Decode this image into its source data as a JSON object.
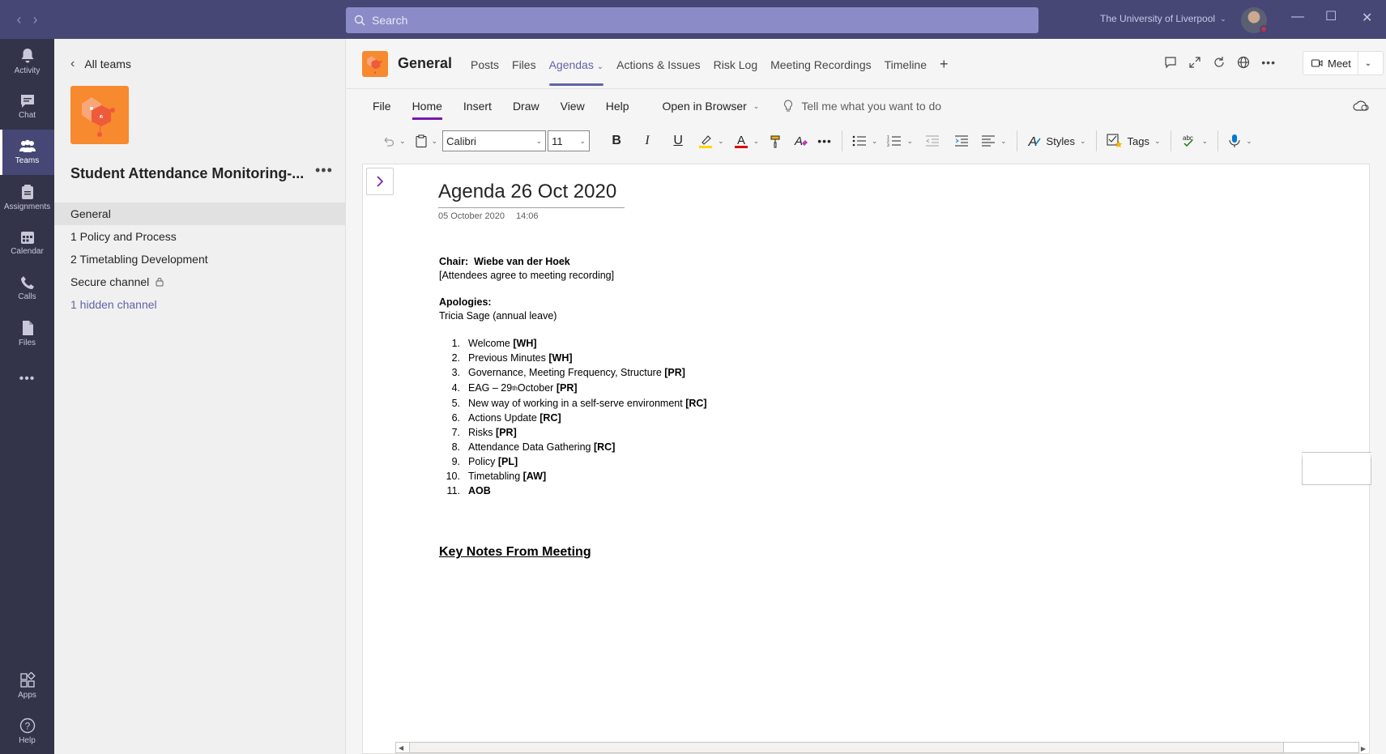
{
  "titlebar": {
    "back_label": "‹",
    "forward_label": "›",
    "search_placeholder": "Search",
    "org_name": "The University of Liverpool",
    "minimize": "—",
    "maximize": "☐",
    "close": "✕"
  },
  "rail": {
    "items": [
      {
        "label": "Activity",
        "icon": "bell-icon"
      },
      {
        "label": "Chat",
        "icon": "chat-icon"
      },
      {
        "label": "Teams",
        "icon": "teams-icon",
        "active": true
      },
      {
        "label": "Assignments",
        "icon": "assignments-icon"
      },
      {
        "label": "Calendar",
        "icon": "calendar-icon"
      },
      {
        "label": "Calls",
        "icon": "phone-icon"
      },
      {
        "label": "Files",
        "icon": "files-icon"
      }
    ],
    "more": "•••",
    "bottom": [
      {
        "label": "Apps",
        "icon": "apps-icon"
      },
      {
        "label": "Help",
        "icon": "help-icon"
      }
    ]
  },
  "pane": {
    "all_teams": "All teams",
    "team_name": "Student Attendance Monitoring-...",
    "more": "•••",
    "channels": [
      {
        "label": "General",
        "active": true
      },
      {
        "label": "1 Policy and Process"
      },
      {
        "label": "2 Timetabling Development"
      },
      {
        "label": "Secure channel",
        "locked": true
      },
      {
        "label": "1 hidden channel",
        "link": true
      }
    ]
  },
  "header": {
    "channel_title": "General",
    "tabs": [
      {
        "label": "Posts"
      },
      {
        "label": "Files"
      },
      {
        "label": "Agendas",
        "active": true
      },
      {
        "label": "Actions & Issues"
      },
      {
        "label": "Risk Log"
      },
      {
        "label": "Meeting Recordings"
      },
      {
        "label": "Timeline"
      },
      {
        "label": "+"
      }
    ],
    "meet_label": "Meet"
  },
  "ribbon": {
    "menu": [
      "File",
      "Home",
      "Insert",
      "Draw",
      "View",
      "Help"
    ],
    "active_menu": "Home",
    "open_in_browser": "Open in Browser",
    "tell_me": "Tell me what you want to do",
    "font_name": "Calibri",
    "font_size": "11",
    "styles": "Styles",
    "tags": "Tags",
    "spell": "abc"
  },
  "page": {
    "title": "Agenda 26 Oct 2020",
    "date": "05 October 2020",
    "time": "14:06",
    "chair_label": "Chair:",
    "chair_name": "Wiebe van der Hoek",
    "attendees_note": "[Attendees agree to meeting recording]",
    "apologies_label": "Apologies:",
    "apologies": "Tricia Sage (annual leave)",
    "agenda": [
      {
        "num": "1.",
        "text": "Welcome ",
        "tag": "[WH]"
      },
      {
        "num": "2.",
        "text": "Previous Minutes ",
        "tag": "[WH]"
      },
      {
        "num": "3.",
        "text": "Governance, Meeting Frequency, Structure ",
        "tag": "[PR]"
      },
      {
        "num": "4.",
        "text": "EAG – 29",
        "sup": "th",
        "text2": " October ",
        "tag": "[PR]"
      },
      {
        "num": "5.",
        "text": "New way of working in a self-serve environment ",
        "tag": "[RC]"
      },
      {
        "num": "6.",
        "text": "Actions Update ",
        "tag": "[RC]"
      },
      {
        "num": "7.",
        "text": "Risks ",
        "tag": "[PR]"
      },
      {
        "num": "8.",
        "text": "Attendance Data Gathering ",
        "tag": "[RC]"
      },
      {
        "num": "9.",
        "text": "Policy ",
        "tag": "[PL]"
      },
      {
        "num": "10.",
        "text": "Timetabling ",
        "tag": "[AW]"
      },
      {
        "num": "11.",
        "text": "",
        "tag": "AOB"
      }
    ],
    "key_notes": "Key Notes From Meeting"
  },
  "colors": {
    "titlebar": "#464775",
    "rail": "#33344a",
    "accent": "#6264a7",
    "onenote": "#7719aa",
    "team_logo": "#f7892f"
  }
}
